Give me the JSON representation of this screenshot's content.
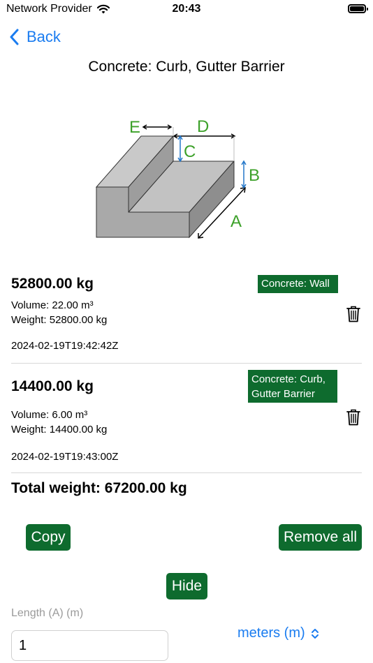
{
  "status": {
    "carrier": "Network Provider",
    "time": "20:43"
  },
  "nav": {
    "back_label": "Back"
  },
  "page": {
    "title": "Concrete: Curb, Gutter Barrier"
  },
  "diagram": {
    "labels": {
      "a": "A",
      "b": "B",
      "c": "C",
      "d": "D",
      "e": "E"
    }
  },
  "entries": [
    {
      "weight": "52800.00 kg",
      "volume": "Volume: 22.00 m³",
      "weight_line": "Weight: 52800.00 kg",
      "timestamp": "2024-02-19T19:42:42Z",
      "tag_lines": [
        "Concrete: Wall"
      ]
    },
    {
      "weight": "14400.00 kg",
      "volume": "Volume: 6.00 m³",
      "weight_line": "Weight: 14400.00 kg",
      "timestamp": "2024-02-19T19:43:00Z",
      "tag_lines": [
        "Concrete: Curb,",
        "Gutter Barrier"
      ]
    }
  ],
  "summary": {
    "total": "Total weight: 67200.00 kg"
  },
  "actions": {
    "copy_label": "Copy",
    "remove_all_label": "Remove all",
    "hide_label": "Hide"
  },
  "form": {
    "length_label": "Length (A) (m)",
    "length_value": "1",
    "unit_selected": "meters (m)"
  },
  "colors": {
    "accent_blue": "#1a7cf0",
    "tag_green": "#0e6b2e",
    "label_green": "#3da12a",
    "dim_blue": "#2477c9"
  },
  "icons": [
    "wifi-icon",
    "battery-icon",
    "chevron-left-icon",
    "trash-icon",
    "up-down-chevron-icon"
  ]
}
